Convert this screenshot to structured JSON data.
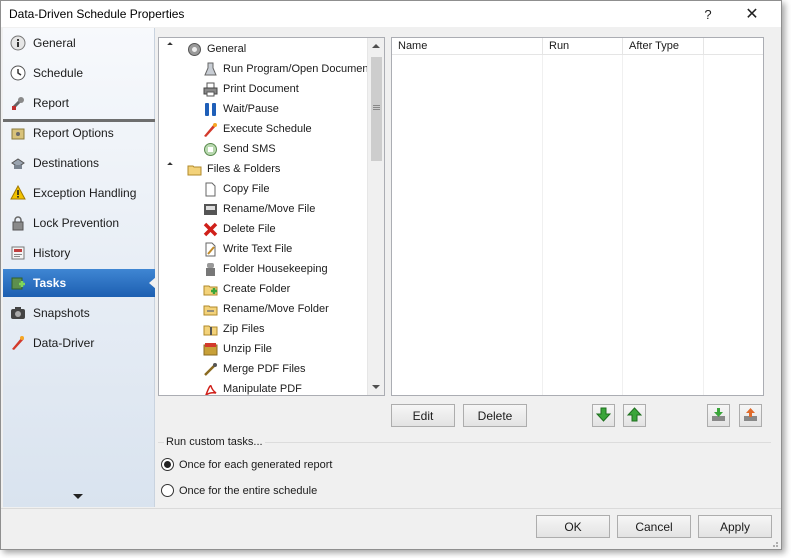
{
  "window": {
    "title": "Data-Driven Schedule Properties",
    "help_label": "?",
    "close_label": "✕"
  },
  "sidebar": {
    "items": [
      {
        "label": "General"
      },
      {
        "label": "Schedule"
      },
      {
        "label": "Report"
      },
      {
        "label": "Report Options"
      },
      {
        "label": "Destinations"
      },
      {
        "label": "Exception Handling"
      },
      {
        "label": "Lock Prevention"
      },
      {
        "label": "History"
      },
      {
        "label": "Tasks"
      },
      {
        "label": "Snapshots"
      },
      {
        "label": "Data-Driver"
      }
    ],
    "active": "Tasks"
  },
  "tree": {
    "groups": [
      {
        "label": "General",
        "items": [
          "Run Program/Open Document",
          "Print Document",
          "Wait/Pause",
          "Execute Schedule",
          "Send SMS"
        ]
      },
      {
        "label": "Files & Folders",
        "items": [
          "Copy File",
          "Rename/Move File",
          "Delete File",
          "Write Text File",
          "Folder Housekeeping",
          "Create Folder",
          "Rename/Move Folder",
          "Zip Files",
          "Unzip File",
          "Merge PDF Files",
          "Manipulate PDF"
        ]
      }
    ]
  },
  "list": {
    "columns": [
      "Name",
      "Run",
      "After Type",
      ""
    ]
  },
  "buttons": {
    "edit": "Edit",
    "delete": "Delete",
    "ok": "OK",
    "cancel": "Cancel",
    "apply": "Apply"
  },
  "custom_tasks": {
    "label": "Run custom tasks...",
    "options": [
      "Once for each generated report",
      "Once for the entire schedule"
    ],
    "selected": 0
  },
  "colors": {
    "active_nav": "#2a6fc4",
    "arrow_green": "#3aa53a"
  }
}
